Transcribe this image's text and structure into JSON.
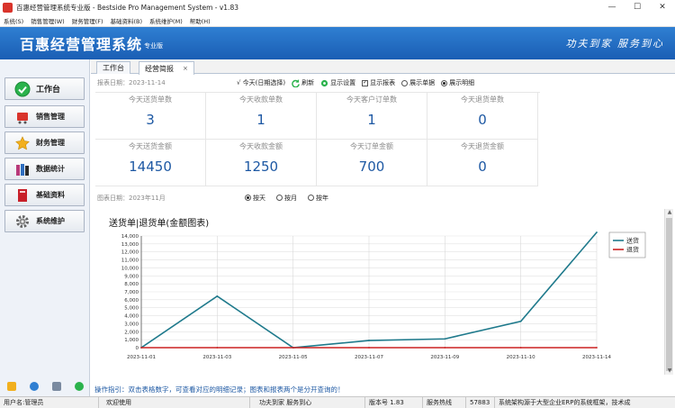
{
  "window": {
    "title": "百惠经营管理系统专业版 - Bestside Pro Management System - v1.83",
    "minimize": "—",
    "maximize": "☐",
    "close": "✕"
  },
  "menu": [
    "系统(S)",
    "销售管理(W)",
    "财务管理(F)",
    "基础资料(B)",
    "系统维护(M)",
    "帮助(H)"
  ],
  "banner": {
    "brand": "百惠经营管理系统",
    "edition": "专业版",
    "slogan": "功夫到家  服务到心"
  },
  "sidebar": {
    "items": [
      {
        "label": "工作台",
        "icon": "check-icon",
        "color": "#2bb24c"
      },
      {
        "label": "销售管理",
        "icon": "cart-icon",
        "color": "#d9342b"
      },
      {
        "label": "财务管理",
        "icon": "star-icon",
        "color": "#f2b01e"
      },
      {
        "label": "数据统计",
        "icon": "books-icon",
        "color": "#b83a7a"
      },
      {
        "label": "基础资料",
        "icon": "book-icon",
        "color": "#c8202a"
      },
      {
        "label": "系统维护",
        "icon": "gear-icon",
        "color": "#666666"
      }
    ],
    "bottom_icons": [
      "note-icon",
      "info-icon",
      "doc-icon",
      "add-icon"
    ]
  },
  "tabs": [
    {
      "label": "工作台"
    },
    {
      "label": "经营简报",
      "close": "×"
    }
  ],
  "toolbar": {
    "report_date": "报表日期：2023-11-14",
    "today_select": "√ 今天(日期选择)",
    "refresh": "刷新",
    "display_settings": "显示设置",
    "show_report": "显示报表",
    "show_summary": "展示单据",
    "show_detail": "展示明细"
  },
  "stats": [
    {
      "caption": "今天送货单数",
      "value": "3"
    },
    {
      "caption": "今天收款单数",
      "value": "1"
    },
    {
      "caption": "今天客户订单数",
      "value": "1"
    },
    {
      "caption": "今天退货单数",
      "value": "0"
    },
    {
      "caption": "今天送货金额",
      "value": "14450"
    },
    {
      "caption": "今天收款金额",
      "value": "1250"
    },
    {
      "caption": "今天订单金额",
      "value": "700"
    },
    {
      "caption": "今天退货金额",
      "value": "0"
    }
  ],
  "chart_filter": {
    "chart_date": "图表日期：2023年11月",
    "by_day": "按天",
    "by_month": "按月",
    "by_year": "按年"
  },
  "chart_data": {
    "type": "line",
    "title": "送货单|退货单(金额图表)",
    "categories": [
      "2023-11-01",
      "2023-11-03",
      "2023-11-05",
      "2023-11-07",
      "2023-11-09",
      "2023-11-10",
      "2023-11-14"
    ],
    "series": [
      {
        "name": "送货",
        "color": "#1f7a8c",
        "values": [
          0,
          6450,
          0,
          900,
          1100,
          3300,
          14450
        ]
      },
      {
        "name": "退货",
        "color": "#cc2222",
        "values": [
          0,
          0,
          0,
          0,
          0,
          0,
          0
        ]
      }
    ],
    "ylim": [
      0,
      14000
    ],
    "yticks": [
      "0",
      "1,000",
      "2,000",
      "3,000",
      "4,000",
      "5,000",
      "6,000",
      "7,000",
      "8,000",
      "9,000",
      "10,000",
      "11,000",
      "12,000",
      "13,000",
      "14,000"
    ],
    "grid": true,
    "legend": "top-right"
  },
  "hint": "操作指引：双击表格数字，可查看对应的明细记录；图表和报表两个是分开查询的！",
  "status": {
    "user": "用户名:管理员",
    "welcome": "欢迎使用",
    "slogan": "功夫到家  服务到心",
    "version": "版本号 1.83",
    "service": "服务热线",
    "code": "57883",
    "desc": "系统架构源于大型企业ERP的系统框架，技术成"
  }
}
